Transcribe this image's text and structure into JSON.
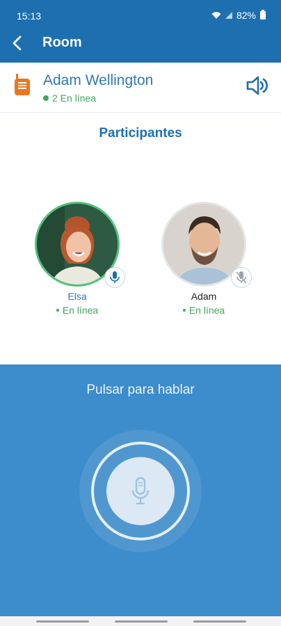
{
  "status_bar": {
    "time": "15:13",
    "battery": "82%",
    "icons": [
      "wifi-icon",
      "signal-icon",
      "battery-icon"
    ]
  },
  "app_bar": {
    "title": "Room",
    "back_icon": "back-arrow-icon"
  },
  "contact": {
    "name": "Adam Wellington",
    "online": "2 En línea",
    "icon": "walkie-talkie-icon",
    "speaker_icon": "speaker-icon"
  },
  "participants": {
    "title": "Participantes",
    "items": [
      {
        "name": "Elsa",
        "status": "En línea",
        "mic": "active"
      },
      {
        "name": "Adam",
        "status": "En línea",
        "mic": "muted"
      }
    ]
  },
  "ptt": {
    "label": "Pulsar para hablar",
    "icon": "microphone-icon"
  },
  "colors": {
    "primary": "#1d6fb0",
    "ptt_bg": "#3d8ccb",
    "online": "#3ba85a",
    "accent_orange": "#e87722"
  }
}
